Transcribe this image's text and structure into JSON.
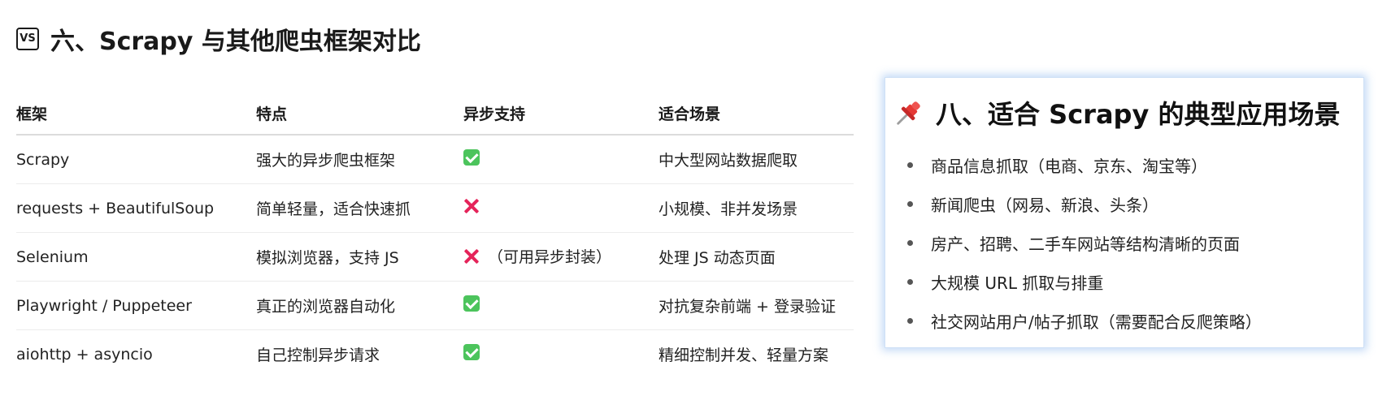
{
  "comparison": {
    "icon": "vs-icon",
    "icon_text": "VS",
    "title": "六、Scrapy 与其他爬虫框架对比",
    "headers": [
      "框架",
      "特点",
      "异步支持",
      "适合场景"
    ],
    "rows": [
      {
        "framework": "Scrapy",
        "feature": "强大的异步爬虫框架",
        "async_support": "check",
        "async_note": "",
        "scenario": "中大型网站数据爬取"
      },
      {
        "framework": "requests + BeautifulSoup",
        "feature": "简单轻量，适合快速抓",
        "async_support": "cross",
        "async_note": "",
        "scenario": "小规模、非并发场景"
      },
      {
        "framework": "Selenium",
        "feature": "模拟浏览器，支持 JS",
        "async_support": "cross",
        "async_note": "（可用异步封装）",
        "scenario": "处理 JS 动态页面"
      },
      {
        "framework": "Playwright / Puppeteer",
        "feature": "真正的浏览器自动化",
        "async_support": "check",
        "async_note": "",
        "scenario": "对抗复杂前端 + 登录验证"
      },
      {
        "framework": "aiohttp + asyncio",
        "feature": "自己控制异步请求",
        "async_support": "check",
        "async_note": "",
        "scenario": "精细控制并发、轻量方案"
      }
    ]
  },
  "scenarios": {
    "icon": "pushpin-icon",
    "title": "八、适合 Scrapy 的典型应用场景",
    "items": [
      "商品信息抓取（电商、京东、淘宝等）",
      "新闻爬虫（网易、新浪、头条）",
      "房产、招聘、二手车网站等结构清晰的页面",
      "大规模 URL 抓取与排重",
      "社交网站用户/帖子抓取（需要配合反爬策略）"
    ]
  },
  "colors": {
    "check_green": "#4cc45c",
    "cross_red": "#e5245a",
    "card_glow": "#78aaeb",
    "pin_red": "#e53935"
  }
}
